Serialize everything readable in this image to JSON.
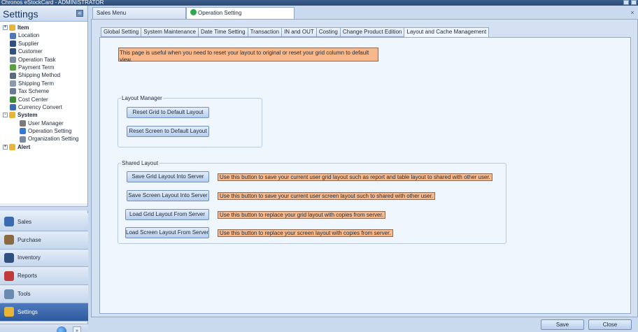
{
  "window": {
    "title": "Chronos eStockCard - ADMINISTRATOR"
  },
  "sidebar": {
    "title": "Settings",
    "tree": [
      {
        "label": "Item",
        "level": 0,
        "bold": true,
        "expander": "+",
        "icon_color": "#e8b53a"
      },
      {
        "label": "Location",
        "level": 1,
        "icon_color": "#4a78b8"
      },
      {
        "label": "Supplier",
        "level": 1,
        "icon_color": "#2f4f80"
      },
      {
        "label": "Customer",
        "level": 1,
        "icon_color": "#2f4f80"
      },
      {
        "label": "Operation Task",
        "level": 1,
        "icon_color": "#7a8aa0"
      },
      {
        "label": "Payment Term",
        "level": 1,
        "icon_color": "#5aa040"
      },
      {
        "label": "Shipping Method",
        "level": 1,
        "icon_color": "#5a6a80"
      },
      {
        "label": "Shipping Term",
        "level": 1,
        "icon_color": "#8a9ab0"
      },
      {
        "label": "Tax Scheme",
        "level": 1,
        "icon_color": "#6a7a90"
      },
      {
        "label": "Cost Center",
        "level": 1,
        "icon_color": "#3a8a3a"
      },
      {
        "label": "Currency Convert",
        "level": 1,
        "icon_color": "#3a6ab0"
      },
      {
        "label": "System",
        "level": 0,
        "bold": true,
        "expander": "-",
        "icon_color": "#e8b53a"
      },
      {
        "label": "User Manager",
        "level": 2,
        "icon_color": "#7a7a7a"
      },
      {
        "label": "Operation Setting",
        "level": 2,
        "icon_color": "#3a78d0"
      },
      {
        "label": "Organization Setting",
        "level": 2,
        "icon_color": "#7a8aa0"
      },
      {
        "label": "Alert",
        "level": 0,
        "bold": true,
        "expander": "+",
        "icon_color": "#e8b53a"
      }
    ],
    "nav": [
      {
        "label": "Sales",
        "icon_color": "#3a6ab0",
        "active": false
      },
      {
        "label": "Purchase",
        "icon_color": "#8a6a40",
        "active": false
      },
      {
        "label": "Inventory",
        "icon_color": "#2f4f80",
        "active": false
      },
      {
        "label": "Reports",
        "icon_color": "#c03a3a",
        "active": false
      },
      {
        "label": "Tools",
        "icon_color": "#6a8ab0",
        "active": false
      },
      {
        "label": "Settings",
        "icon_color": "#e8b53a",
        "active": true
      }
    ]
  },
  "doc_tabs": [
    {
      "label": "Sales Menu",
      "active": false
    },
    {
      "label": "Operation Setting",
      "active": true
    }
  ],
  "tabs": [
    {
      "label": "Global Setting"
    },
    {
      "label": "System Maintenance"
    },
    {
      "label": "Date Time Setting"
    },
    {
      "label": "Transaction"
    },
    {
      "label": "IN and OUT"
    },
    {
      "label": "Costing"
    },
    {
      "label": "Change Product Edition"
    },
    {
      "label": "Layout and Cache Management",
      "active": true
    }
  ],
  "page": {
    "info": "This page is useful when you need to reset your layout to original or reset your grid column to default view.",
    "layout_manager": {
      "title": "Layout Manager",
      "reset_grid": "Reset Grid to Default Layout",
      "reset_screen": "Reset Screen to Default Layout"
    },
    "shared_layout": {
      "title": "Shared Layout",
      "save_grid": "Save Grid Layout Into Server",
      "save_grid_note": "Use this button to save your current user grid layout such as report and table layout to shared with other user.",
      "save_screen": "Save Screen Layout Into Server",
      "save_screen_note": "Use this button to save your current user screen layout such to shared with other user.",
      "load_grid": "Load Grid Layout From Server",
      "load_grid_note": "Use this button to replace your grid layout with copies from server.",
      "load_screen": "Load Screen Layout From Server",
      "load_screen_note": "Use this button to replace your screen layout with copies from server."
    }
  },
  "footer": {
    "save": "Save",
    "close": "Close"
  }
}
